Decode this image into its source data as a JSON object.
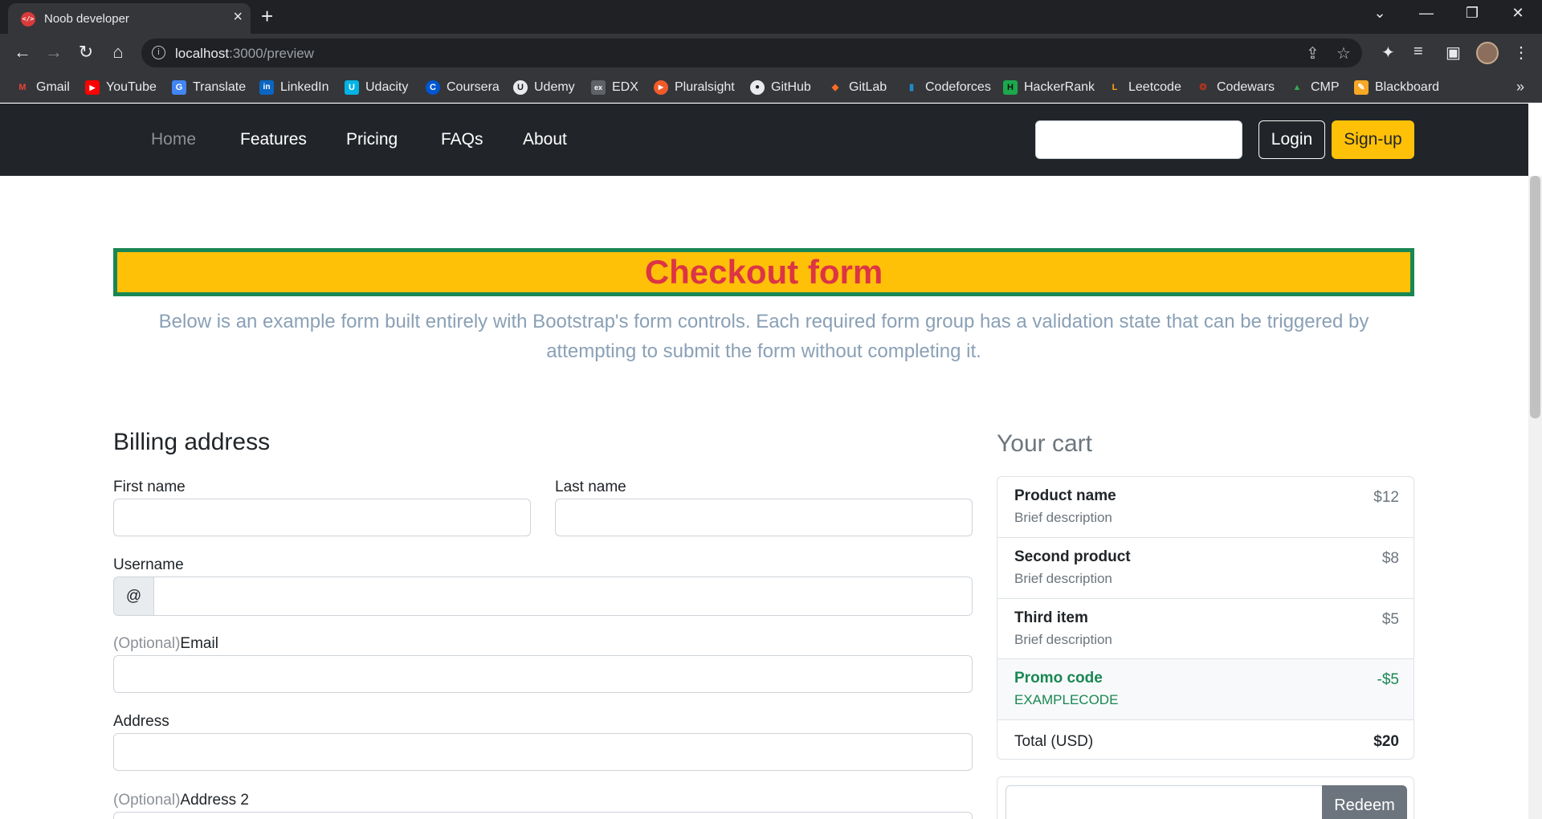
{
  "browser": {
    "tab_title": "Noob developer",
    "favicon_text": "</>",
    "url_host": "localhost",
    "url_path": ":3000/preview",
    "bookmarks": [
      {
        "label": "Gmail",
        "color": "#ea4335",
        "glyph": "M"
      },
      {
        "label": "YouTube",
        "color": "#ff0000",
        "glyph": "▶"
      },
      {
        "label": "Translate",
        "color": "#4285f4",
        "glyph": "G"
      },
      {
        "label": "LinkedIn",
        "color": "#0a66c2",
        "glyph": "in"
      },
      {
        "label": "Udacity",
        "color": "#02b3e4",
        "glyph": "U"
      },
      {
        "label": "Coursera",
        "color": "#0056d2",
        "glyph": "C"
      },
      {
        "label": "Udemy",
        "color": "#e8eaed",
        "glyph": "U"
      },
      {
        "label": "EDX",
        "color": "#5f6368",
        "glyph": "ex"
      },
      {
        "label": "Pluralsight",
        "color": "#f15b2a",
        "glyph": "▶"
      },
      {
        "label": "GitHub",
        "color": "#e8eaed",
        "glyph": "●"
      },
      {
        "label": "GitLab",
        "color": "#fc6d26",
        "glyph": "◆"
      },
      {
        "label": "Codeforces",
        "color": "#1f8acb",
        "glyph": "▮"
      },
      {
        "label": "HackerRank",
        "color": "#1ba94c",
        "glyph": "H"
      },
      {
        "label": "Leetcode",
        "color": "#ffa116",
        "glyph": "L"
      },
      {
        "label": "Codewars",
        "color": "#b1361e",
        "glyph": "❂"
      },
      {
        "label": "CMP",
        "color": "#34a853",
        "glyph": "▲"
      },
      {
        "label": "Blackboard",
        "color": "#f9a825",
        "glyph": "✎"
      }
    ]
  },
  "nav": {
    "links": [
      "Home",
      "Features",
      "Pricing",
      "FAQs",
      "About"
    ],
    "login": "Login",
    "signup": "Sign-up"
  },
  "header": {
    "title": "Checkout form",
    "lead": "Below is an example form built entirely with Bootstrap's form controls. Each required form group has a validation state that can be triggered by attempting to submit the form without completing it."
  },
  "billing": {
    "heading": "Billing address",
    "first_name": "First name",
    "last_name": "Last name",
    "username": "Username",
    "at": "@",
    "optional": "(Optional)",
    "email": "Email",
    "address": "Address",
    "address2": "Address 2"
  },
  "cart": {
    "heading": "Your cart",
    "items": [
      {
        "name": "Product name",
        "desc": "Brief description",
        "price": "$12"
      },
      {
        "name": "Second product",
        "desc": "Brief description",
        "price": "$8"
      },
      {
        "name": "Third item",
        "desc": "Brief description",
        "price": "$5"
      }
    ],
    "promo": {
      "name": "Promo code",
      "code": "EXAMPLECODE",
      "amount": "-$5"
    },
    "total_label": "Total (USD)",
    "total_value": "$20",
    "redeem": "Redeem"
  }
}
